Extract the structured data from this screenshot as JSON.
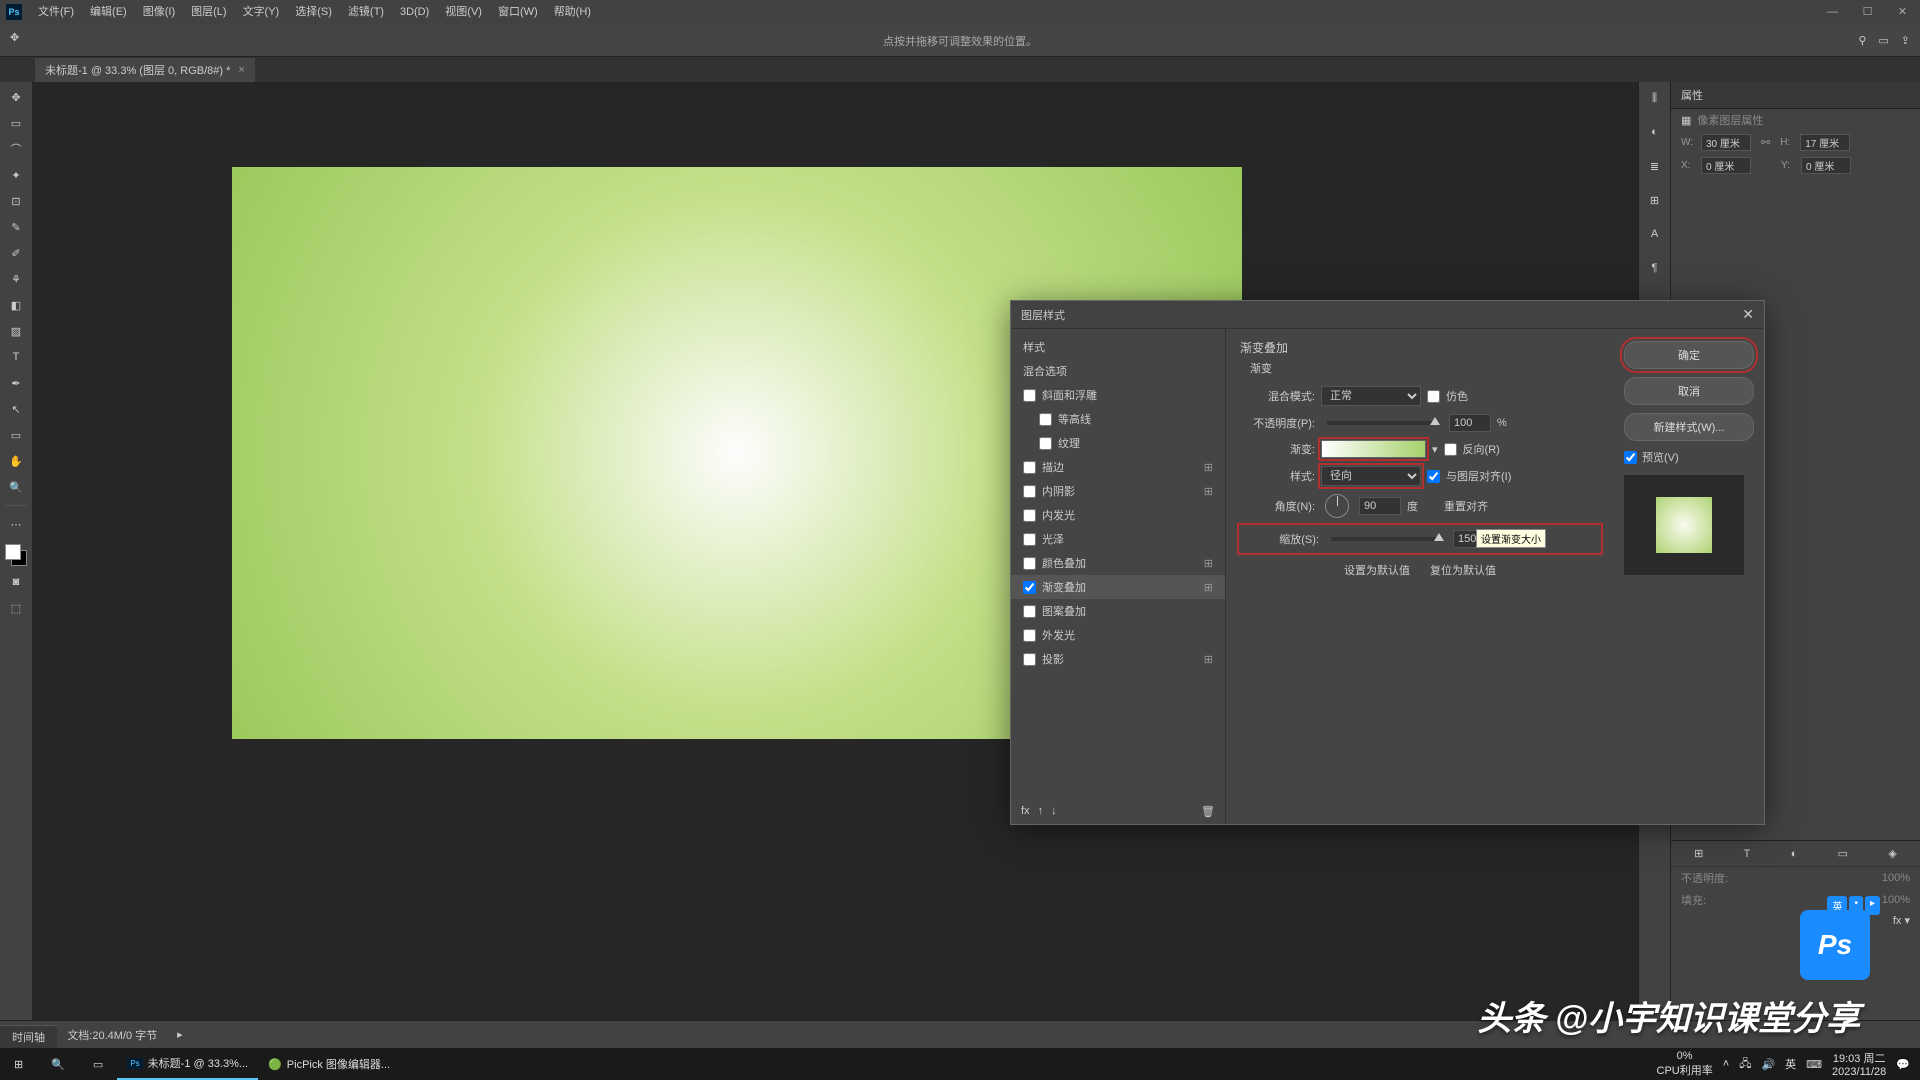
{
  "menu": {
    "file": "文件(F)",
    "edit": "编辑(E)",
    "image": "图像(I)",
    "layer": "图层(L)",
    "type": "文字(Y)",
    "select": "选择(S)",
    "filter": "滤镜(T)",
    "d3": "3D(D)",
    "view": "视图(V)",
    "window": "窗口(W)",
    "help": "帮助(H)"
  },
  "option_hint": "点按并拖移可调整效果的位置。",
  "tab_title": "未标题-1 @ 33.3% (图层 0, RGB/8#) *",
  "properties": {
    "title": "属性",
    "subtitle": "像素图层属性",
    "w": "30 厘米",
    "h": "17 厘米",
    "x": "0 厘米",
    "y": "0 厘米"
  },
  "layers": {
    "opacity_lbl": "不透明度:",
    "opacity": "100%",
    "fill_lbl": "填充:",
    "fill": "100%"
  },
  "dialog": {
    "title": "图层样式",
    "col1": [
      "样式",
      "混合选项",
      "斜面和浮雕",
      "等高线",
      "纹理",
      "描边",
      "内阴影",
      "内发光",
      "光泽",
      "颜色叠加",
      "渐变叠加",
      "图案叠加",
      "外发光",
      "投影"
    ],
    "section": "渐变叠加",
    "sub": "渐变",
    "blend_lbl": "混合模式:",
    "blend_val": "正常",
    "dither": "仿色",
    "opacity_lbl": "不透明度(P):",
    "opacity": "100",
    "grad_lbl": "渐变:",
    "reverse": "反向(R)",
    "style_lbl": "样式:",
    "style_val": "径向",
    "align": "与图层对齐(I)",
    "angle_lbl": "角度(N):",
    "angle": "90",
    "deg": "度",
    "reset_align": "重置对齐",
    "scale_lbl": "缩放(S):",
    "scale": "150",
    "setdef": "设置为默认值",
    "resetdef": "复位为默认值",
    "tooltip": "设置渐变大小",
    "ok": "确定",
    "cancel": "取消",
    "newstyle": "新建样式(W)...",
    "preview": "预览(V)"
  },
  "status": {
    "zoom": "33.33%",
    "doc": "文档:20.4M/0 字节",
    "timeline": "时间轴"
  },
  "taskbar": {
    "app1": "未标题-1 @ 33.3%...",
    "app2": "PicPick 图像编辑器...",
    "cpu_pct": "0%",
    "cpu_lbl": "CPU利用率",
    "lang": "英",
    "time": "19:03 周二",
    "date": "2023/11/28"
  },
  "watermark": "头条 @小宇知识课堂分享",
  "pct": "%"
}
